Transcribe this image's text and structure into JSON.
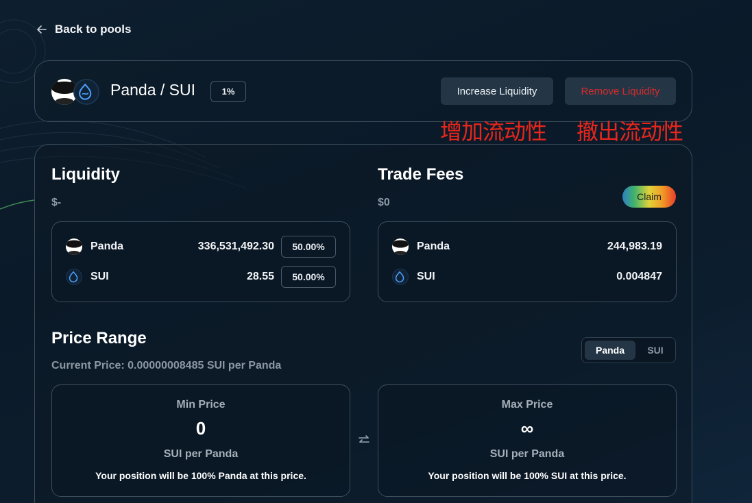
{
  "nav": {
    "back_label": "Back to pools"
  },
  "pool": {
    "title": "Panda / SUI",
    "fee_tier": "1%",
    "increase_label": "Increase Liquidity",
    "remove_label": "Remove Liquidity"
  },
  "annotations": {
    "increase_note": "增加流动性",
    "remove_note": "撤出流动性",
    "color": "#e8261c"
  },
  "liquidity": {
    "title": "Liquidity",
    "value": "$-",
    "tokens": [
      {
        "name": "Panda",
        "amount": "336,531,492.30",
        "share": "50.00%",
        "icon": "panda-icon"
      },
      {
        "name": "SUI",
        "amount": "28.55",
        "share": "50.00%",
        "icon": "sui-icon"
      }
    ]
  },
  "trade_fees": {
    "title": "Trade Fees",
    "value": "$0",
    "claim_label": "Claim",
    "tokens": [
      {
        "name": "Panda",
        "amount": "244,983.19",
        "icon": "panda-icon"
      },
      {
        "name": "SUI",
        "amount": "0.004847",
        "icon": "sui-icon"
      }
    ]
  },
  "price_range": {
    "title": "Price Range",
    "current_price": "Current Price: 0.00000008485 SUI per Panda",
    "toggle": {
      "options": [
        "Panda",
        "SUI"
      ],
      "selected": "Panda"
    },
    "min": {
      "label": "Min Price",
      "value": "0",
      "unit": "SUI per Panda",
      "note": "Your position will be 100% Panda at this price."
    },
    "max": {
      "label": "Max Price",
      "value": "∞",
      "unit": "SUI per Panda",
      "note": "Your position will be 100% SUI at this price."
    }
  },
  "colors": {
    "background": "#0d1e2e",
    "button_bg": "#243646",
    "remove_text": "#d62b2b",
    "muted_text": "#8b97a3",
    "sui_blue": "#4da2ff"
  }
}
